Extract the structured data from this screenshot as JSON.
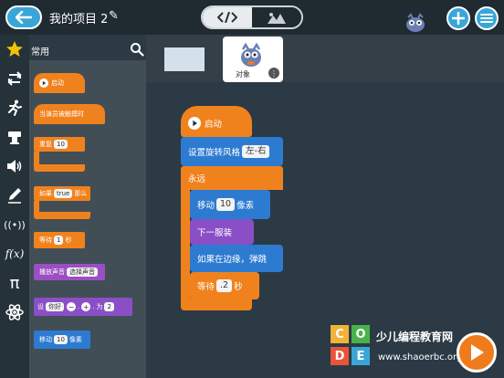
{
  "header": {
    "project_title": "我的项目 2",
    "view_toggle": {
      "code_icon": "code-icon",
      "scene_icon": "mountain-icon"
    }
  },
  "sidebar": {
    "active_category": "常用",
    "categories": [
      {
        "name": "star-icon"
      },
      {
        "name": "loop-arrows-icon"
      },
      {
        "name": "running-man-icon"
      },
      {
        "name": "costume-icon"
      },
      {
        "name": "speaker-icon"
      },
      {
        "name": "pen-icon"
      },
      {
        "name": "broadcast-icon",
        "label": "((•))"
      },
      {
        "name": "function-icon",
        "label": "f(x)"
      },
      {
        "name": "pi-icon",
        "label": "π"
      },
      {
        "name": "atom-icon"
      }
    ]
  },
  "palette": {
    "blocks": [
      {
        "label": "启动"
      },
      {
        "label": "当演员被触摸时"
      },
      {
        "label": "重复",
        "field": "10"
      },
      {
        "label_pre": "如果",
        "field": "true",
        "label_post": "那么"
      },
      {
        "label": "等待",
        "field": "1",
        "suffix": "秒"
      },
      {
        "label": "播放声音",
        "field": "选择声音"
      },
      {
        "label": "设",
        "field": "你好",
        "minus": "−",
        "plus": "+",
        "label_to": "为",
        "value": "2"
      },
      {
        "label": "移动",
        "field": "10",
        "suffix": "像素"
      }
    ]
  },
  "stage": {
    "sprite_label": "对象"
  },
  "script": {
    "start": "启动",
    "rotation": {
      "label": "设置旋转风格",
      "value": "左-右"
    },
    "forever": "永远",
    "move": {
      "label": "移动",
      "value": "10",
      "suffix": "像素"
    },
    "next_costume": "下一服装",
    "bounce": "如果在边缘，弹跳",
    "wait": {
      "label": "等待",
      "value": ".2",
      "suffix": "秒"
    }
  },
  "watermark": {
    "letters": [
      "C",
      "O",
      "D",
      "E"
    ],
    "text": "少儿编程教育网",
    "url": "www.shaoerbc.org"
  },
  "colors": {
    "event": "#f0821e",
    "motion": "#2d7bd1",
    "looks": "#8a4fc6",
    "sound": "#9b4fc4",
    "accent": "#3aa6d8"
  }
}
